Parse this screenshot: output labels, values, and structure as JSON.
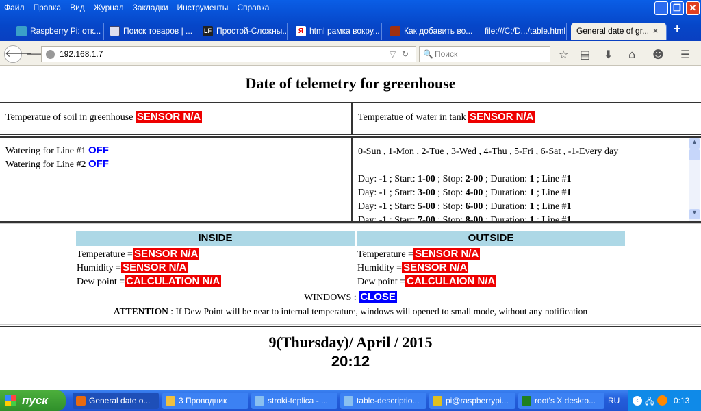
{
  "browser": {
    "menu": [
      "Файл",
      "Правка",
      "Вид",
      "Журнал",
      "Закладки",
      "Инструменты",
      "Справка"
    ],
    "tabs": [
      {
        "label": "Raspberry Pi: отк...",
        "icon": "chat-icon",
        "color": "#3aa0c8"
      },
      {
        "label": "Поиск товаров | ...",
        "icon": "page-icon",
        "color": "#dde"
      },
      {
        "label": "Простой-Сложны...",
        "icon": "lf-logo-icon",
        "color": "#222"
      },
      {
        "label": "html рамка вокру...",
        "icon": "yandex-icon",
        "color": "#fff"
      },
      {
        "label": "Как добавить во...",
        "icon": "blocks-icon",
        "color": "#a03010"
      },
      {
        "label": "file:///C:/D.../table.html",
        "icon": "",
        "color": ""
      },
      {
        "label": "General date of gr...",
        "icon": "",
        "color": ""
      }
    ],
    "url": "192.168.1.7",
    "search_placeholder": "Поиск"
  },
  "page": {
    "title": "Date of telemetry for greenhouse",
    "soil_label": "Temperatue of soil in greenhouse ",
    "soil_value": "SENSOR N/A",
    "water_label": "Temperatue of water in tank ",
    "water_value": "SENSOR N/A",
    "watering": [
      {
        "label": "Watering for Line #1 ",
        "state": "OFF"
      },
      {
        "label": "Watering for Line #2 ",
        "state": "OFF"
      }
    ],
    "day_legend": "0-Sun , 1-Mon , 2-Tue , 3-Wed , 4-Thu , 5-Fri , 6-Sat , -1-Every day",
    "schedule": [
      {
        "day": "-1",
        "start": "1-00",
        "stop": "2-00",
        "duration": "1",
        "line": "1"
      },
      {
        "day": "-1",
        "start": "3-00",
        "stop": "4-00",
        "duration": "1",
        "line": "1"
      },
      {
        "day": "-1",
        "start": "5-00",
        "stop": "6-00",
        "duration": "1",
        "line": "1"
      },
      {
        "day": "-1",
        "start": "7-00",
        "stop": "8-00",
        "duration": "1",
        "line": "1"
      }
    ],
    "inside": {
      "header": "INSIDE",
      "temp_label": "Temperature =",
      "temp": "SENSOR N/A",
      "hum_label": "Humidity =",
      "hum": "SENSOR N/A",
      "dew_label": "Dew point =",
      "dew": "CALCULATION N/A"
    },
    "outside": {
      "header": "OUTSIDE",
      "temp_label": "Temperature =",
      "temp": "SENSOR N/A",
      "hum_label": "Humidity =",
      "hum": "SENSOR N/A",
      "dew_label": "Dew point =",
      "dew": "CALCULAION N/A"
    },
    "windows_label": "WINDOWS : ",
    "windows_state": "CLOSE",
    "attention_label": "ATTENTION",
    "attention_text": " : If Dew Point will be near to internal temperature, windows will opened to small mode, without any notification",
    "date": "9(Thursday)/ April / 2015",
    "time": "20:12"
  },
  "taskbar": {
    "start": "пуск",
    "items": [
      {
        "label": "General date o...",
        "color": "#e86a10"
      },
      {
        "label": "3 Проводник",
        "color": "#f0c040"
      },
      {
        "label": "stroki-teplica - ...",
        "color": "#8ac0f0"
      },
      {
        "label": "table-descriptio...",
        "color": "#8ac0f0"
      },
      {
        "label": "pi@raspberrypi...",
        "color": "#e0c020"
      },
      {
        "label": "root's X deskto...",
        "color": "#208020"
      }
    ],
    "lang": "RU",
    "clock": "0:13"
  }
}
